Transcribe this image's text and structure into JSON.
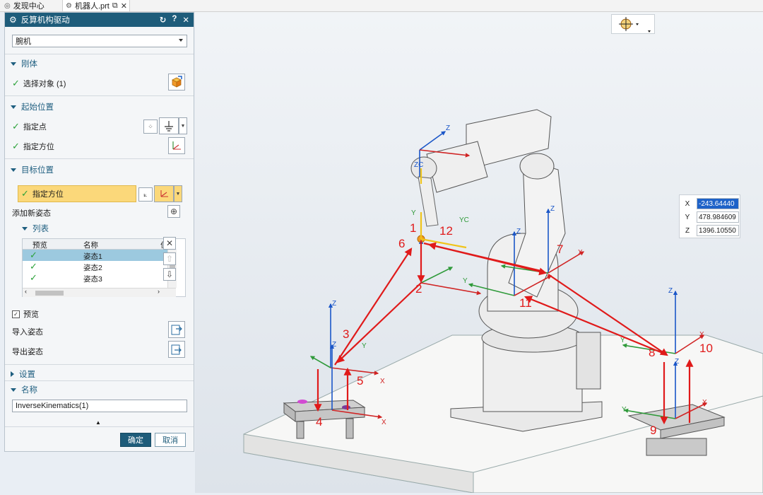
{
  "tabs": [
    {
      "label": "发现中心"
    },
    {
      "label": "机器人.prt"
    }
  ],
  "dialog": {
    "title": "反算机构驱动",
    "type_select": "腕机",
    "sections": {
      "rigid_body": "刚体",
      "start_pos": "起始位置",
      "target_pos": "目标位置",
      "list": "列表",
      "settings": "设置",
      "name": "名称"
    },
    "rigid": {
      "select_object": "选择对象 (1)"
    },
    "start": {
      "point": "指定点",
      "orientation": "指定方位"
    },
    "target": {
      "orientation": "指定方位",
      "add_pose": "添加新姿态",
      "table": {
        "headers": [
          "预览",
          "名称",
          "位"
        ],
        "rows": [
          {
            "name": "姿态1"
          },
          {
            "name": "姿态2"
          },
          {
            "name": "姿态3"
          }
        ]
      },
      "preview": "预览",
      "import": "导入姿态",
      "export": "导出姿态"
    },
    "name_value": "InverseKinematics(1)",
    "ok": "确定",
    "cancel": "取消"
  },
  "coords": {
    "x_label": "X",
    "x": "-243.64440",
    "y_label": "Y",
    "y": "478.984609",
    "z_label": "Z",
    "z": "1396.10550"
  },
  "annotations": [
    "1",
    "2",
    "3",
    "4",
    "5",
    "6",
    "7",
    "8",
    "9",
    "10",
    "11",
    "12"
  ],
  "axis_labels": {
    "x": "X",
    "y": "Y",
    "z": "Z",
    "yc": "YC",
    "zc": "ZC"
  },
  "colors": {
    "accent": "#1e5c7a",
    "annotation_red": "#e01a1a",
    "axis_blue": "#1a56c8",
    "axis_green": "#2f9a3a",
    "highlight": "#fbd87a"
  }
}
